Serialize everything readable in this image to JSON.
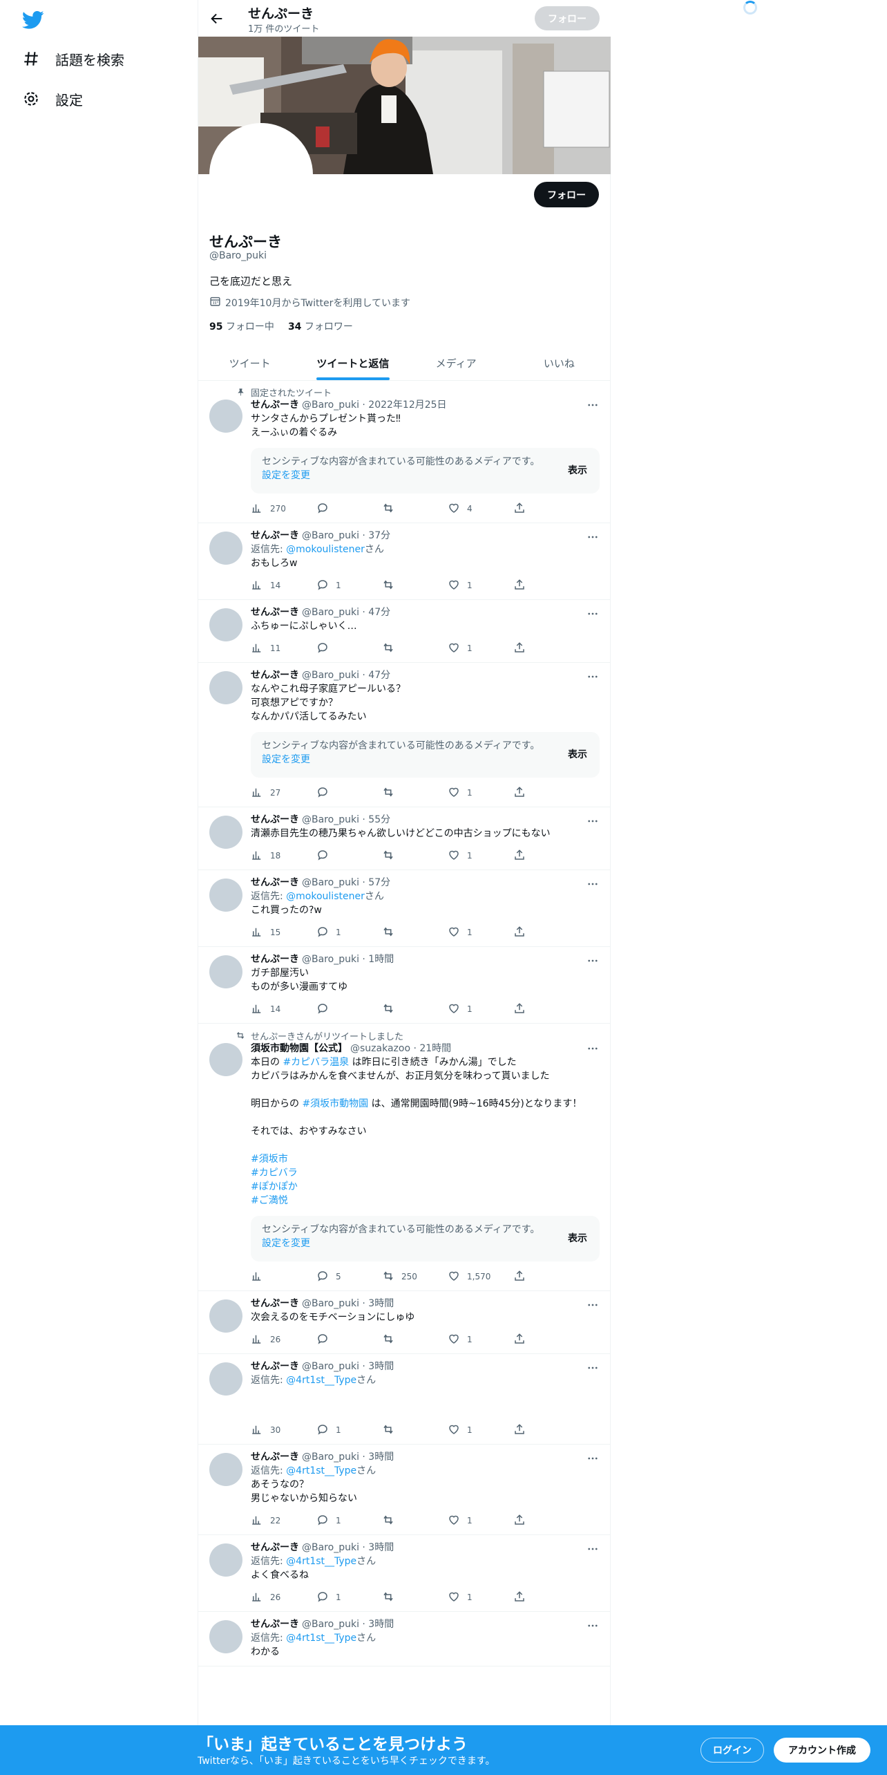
{
  "sidebar": {
    "logo_icon": "twitter-bird-icon",
    "items": [
      {
        "label": "話題を検索",
        "icon": "hashtag-icon"
      },
      {
        "label": "設定",
        "icon": "gear-icon"
      }
    ]
  },
  "header": {
    "name": "せんぷーき",
    "tweet_count": "1万 件のツイート",
    "follow_label": "フォロー"
  },
  "profile": {
    "name": "せんぷーき",
    "handle": "@Baro_puki",
    "bio": "己を底辺だと思え",
    "joined": "2019年10月からTwitterを利用しています",
    "following_count": "95",
    "following_label": "フォロー中",
    "followers_count": "34",
    "followers_label": "フォロワー",
    "follow_label": "フォロー"
  },
  "tabs": [
    {
      "label": "ツイート",
      "active": false
    },
    {
      "label": "ツイートと返信",
      "active": true
    },
    {
      "label": "メディア",
      "active": false
    },
    {
      "label": "いいね",
      "active": false
    }
  ],
  "sensitive": {
    "text": "センシティブな内容が含まれている可能性のあるメディアです。",
    "link": "設定を変更",
    "show": "表示"
  },
  "reply_prefix": "返信先: ",
  "reply_suffix": "さん",
  "tweets": [
    {
      "meta": "固定されたツイート",
      "name": "せんぷーき",
      "handle": "@Baro_puki · 2022年12月25日",
      "text": "サンタさんからプレゼント貰った‼︎\nえーふぃの着ぐるみ",
      "views": "270",
      "replies": "",
      "retweets": "",
      "likes": "4"
    },
    {
      "name": "せんぷーき",
      "handle": "@Baro_puki · 37分",
      "reply_to": "@mokoulistener",
      "text": "おもしろw",
      "views": "14",
      "replies": "1",
      "retweets": "",
      "likes": "1"
    },
    {
      "name": "せんぷーき",
      "handle": "@Baro_puki · 47分",
      "text": "ふちゅーにぷしゃいく…",
      "views": "11",
      "replies": "",
      "retweets": "",
      "likes": "1"
    },
    {
      "name": "せんぷーき",
      "handle": "@Baro_puki · 47分",
      "text": "なんやこれ母子家庭アピールいる？\n可哀想アピですか？\nなんかパパ活してるみたい",
      "views": "27",
      "replies": "",
      "retweets": "",
      "likes": "1"
    },
    {
      "name": "せんぷーき",
      "handle": "@Baro_puki · 55分",
      "text": "清瀬赤目先生の穂乃果ちゃん欲しいけどどこの中古ショップにもない",
      "views": "18",
      "replies": "",
      "retweets": "",
      "likes": "1"
    },
    {
      "name": "せんぷーき",
      "handle": "@Baro_puki · 57分",
      "reply_to": "@mokoulistener",
      "text": "これ買ったの?w",
      "views": "15",
      "replies": "1",
      "retweets": "",
      "likes": "1"
    },
    {
      "name": "せんぷーき",
      "handle": "@Baro_puki · 1時間",
      "text": "ガチ部屋汚い\nものが多い漫画すてゆ",
      "views": "14",
      "replies": "",
      "retweets": "",
      "likes": "1"
    },
    {
      "meta": "せんぷーきさんがリツイートしました",
      "name": "須坂市動物園【公式】",
      "handle": "@suzakazoo · 21時間",
      "text_parts": [
        {
          "t": "本日の "
        },
        {
          "h": "#カピバラ温泉"
        },
        {
          "t": " は昨日に引き続き「みかん湯」でした\nカピバラはみかんを食べませんが、お正月気分を味わって貰いました\n\n明日からの "
        },
        {
          "h": "#須坂市動物園"
        },
        {
          "t": " は、通常開園時間(9時~16時45分)となります！\n\nそれでは、おやすみなさい\n\n "
        },
        {
          "h": "#須坂市"
        },
        {
          "t": "\n"
        },
        {
          "h": "#カピバラ"
        },
        {
          "t": "\n "
        },
        {
          "h": "#ぽかぽか"
        },
        {
          "t": "\n "
        },
        {
          "h": "#ご満悦"
        }
      ],
      "views": "",
      "replies": "5",
      "retweets": "250",
      "likes": "1,570"
    },
    {
      "name": "せんぷーき",
      "handle": "@Baro_puki · 3時間",
      "text": "次会えるのをモチベーションにしゅゆ",
      "views": "26",
      "replies": "",
      "retweets": "",
      "likes": "1"
    },
    {
      "name": "せんぷーき",
      "handle": "@Baro_puki · 3時間",
      "reply_to": "@4rt1st__Type",
      "text": "",
      "views": "30",
      "replies": "1",
      "retweets": "",
      "likes": "1"
    },
    {
      "name": "せんぷーき",
      "handle": "@Baro_puki · 3時間",
      "reply_to": "@4rt1st__Type",
      "text": "あそうなの？\n男じゃないから知らない",
      "views": "22",
      "replies": "1",
      "retweets": "",
      "likes": "1"
    },
    {
      "name": "せんぷーき",
      "handle": "@Baro_puki · 3時間",
      "reply_to": "@4rt1st__Type",
      "text": "よく食べるね",
      "views": "26",
      "replies": "1",
      "retweets": "",
      "likes": "1"
    },
    {
      "name": "せんぷーき",
      "handle": "@Baro_puki · 3時間",
      "reply_to": "@4rt1st__Type",
      "text": "わかる",
      "views": "",
      "replies": "",
      "retweets": "",
      "likes": ""
    }
  ],
  "bottom_bar": {
    "title": "「いま」起きていることを見つけよう",
    "subtitle": "Twitterなら、「いま」起きていることをいち早くチェックできます。",
    "login": "ログイン",
    "signup": "アカウント作成"
  }
}
